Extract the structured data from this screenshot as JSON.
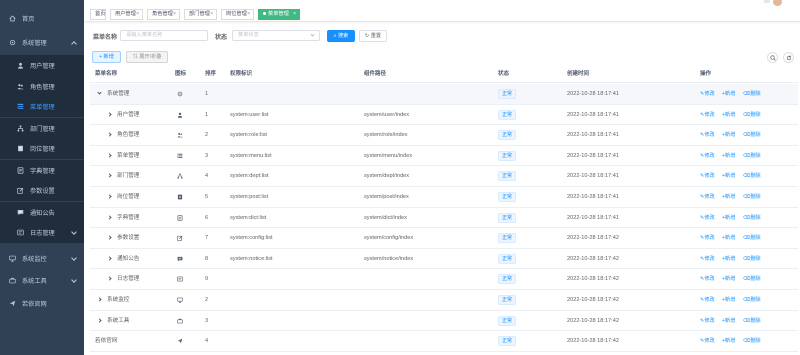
{
  "sidebar": {
    "items": [
      {
        "label": "首页",
        "icon": "home-icon"
      },
      {
        "label": "系统管理",
        "icon": "settings-icon"
      },
      {
        "label": "用户管理",
        "icon": "user-icon"
      },
      {
        "label": "角色管理",
        "icon": "peoples-icon"
      },
      {
        "label": "菜单管理",
        "icon": "tree-table-icon"
      },
      {
        "label": "部门管理",
        "icon": "tree-icon"
      },
      {
        "label": "岗位管理",
        "icon": "post-icon"
      },
      {
        "label": "字典管理",
        "icon": "dict-icon"
      },
      {
        "label": "参数设置",
        "icon": "edit-icon"
      },
      {
        "label": "通知公告",
        "icon": "message-icon"
      },
      {
        "label": "日志管理",
        "icon": "log-icon"
      },
      {
        "label": "系统监控",
        "icon": "monitor-icon"
      },
      {
        "label": "系统工具",
        "icon": "tool-icon"
      },
      {
        "label": "若依官网",
        "icon": "guide-icon"
      }
    ]
  },
  "tags": [
    {
      "label": "首页"
    },
    {
      "label": "用户管理"
    },
    {
      "label": "角色管理"
    },
    {
      "label": "部门管理"
    },
    {
      "label": "岗位管理"
    },
    {
      "label": "菜单管理"
    }
  ],
  "search": {
    "name_label": "菜单名称",
    "name_placeholder": "请输入菜单名称",
    "status_label": "状态",
    "status_placeholder": "菜单状态",
    "search_button": "搜索",
    "reset_button": "重置"
  },
  "toolbar": {
    "add_button": "新增",
    "expand_button": "展开/折叠"
  },
  "table": {
    "columns": [
      "菜单名称",
      "图标",
      "排序",
      "权限标识",
      "组件路径",
      "状态",
      "创建时间",
      "操作"
    ],
    "actions": {
      "edit": "修改",
      "add": "新增",
      "delete": "删除"
    },
    "rows": [
      {
        "name": "系统管理",
        "icon": "settings-icon",
        "order": "1",
        "perm": "",
        "component": "",
        "status": "正常",
        "time": "2022-10-28 18:17:41",
        "level": 0,
        "expand": "open"
      },
      {
        "name": "用户管理",
        "icon": "user-icon",
        "order": "1",
        "perm": "system:user:list",
        "component": "system/user/index",
        "status": "正常",
        "time": "2022-10-28 18:17:41",
        "level": 1,
        "expand": "closed"
      },
      {
        "name": "角色管理",
        "icon": "peoples-icon",
        "order": "2",
        "perm": "system:role:list",
        "component": "system/role/index",
        "status": "正常",
        "time": "2022-10-28 18:17:41",
        "level": 1,
        "expand": "closed"
      },
      {
        "name": "菜单管理",
        "icon": "tree-table-icon",
        "order": "3",
        "perm": "system:menu:list",
        "component": "system/menu/index",
        "status": "正常",
        "time": "2022-10-28 18:17:41",
        "level": 1,
        "expand": "closed"
      },
      {
        "name": "部门管理",
        "icon": "tree-icon",
        "order": "4",
        "perm": "system:dept:list",
        "component": "system/dept/index",
        "status": "正常",
        "time": "2022-10-28 18:17:41",
        "level": 1,
        "expand": "closed"
      },
      {
        "name": "岗位管理",
        "icon": "post-icon",
        "order": "5",
        "perm": "system:post:list",
        "component": "system/post/index",
        "status": "正常",
        "time": "2022-10-28 18:17:41",
        "level": 1,
        "expand": "closed"
      },
      {
        "name": "字典管理",
        "icon": "dict-icon",
        "order": "6",
        "perm": "system:dict:list",
        "component": "system/dict/index",
        "status": "正常",
        "time": "2022-10-28 18:17:41",
        "level": 1,
        "expand": "closed"
      },
      {
        "name": "参数设置",
        "icon": "edit-icon",
        "order": "7",
        "perm": "system:config:list",
        "component": "system/config/index",
        "status": "正常",
        "time": "2022-10-28 18:17:42",
        "level": 1,
        "expand": "closed"
      },
      {
        "name": "通知公告",
        "icon": "message-icon",
        "order": "8",
        "perm": "system:notice:list",
        "component": "system/notice/index",
        "status": "正常",
        "time": "2022-10-28 18:17:42",
        "level": 1,
        "expand": "closed"
      },
      {
        "name": "日志管理",
        "icon": "log-icon",
        "order": "9",
        "perm": "",
        "component": "",
        "status": "正常",
        "time": "2022-10-28 18:17:42",
        "level": 1,
        "expand": "closed"
      },
      {
        "name": "系统监控",
        "icon": "monitor-icon",
        "order": "2",
        "perm": "",
        "component": "",
        "status": "正常",
        "time": "2022-10-28 18:17:42",
        "level": 0,
        "expand": "closed"
      },
      {
        "name": "系统工具",
        "icon": "tool-icon",
        "order": "3",
        "perm": "",
        "component": "",
        "status": "正常",
        "time": "2022-10-28 18:17:42",
        "level": 0,
        "expand": "closed"
      },
      {
        "name": "若依官网",
        "icon": "guide-icon",
        "order": "4",
        "perm": "",
        "component": "",
        "status": "正常",
        "time": "2022-10-28 18:17:42",
        "level": 0,
        "expand": "none"
      }
    ]
  },
  "colors": {
    "sidebar_bg": "#304156",
    "accent": "#1890ff",
    "active_tag": "#42b983"
  }
}
